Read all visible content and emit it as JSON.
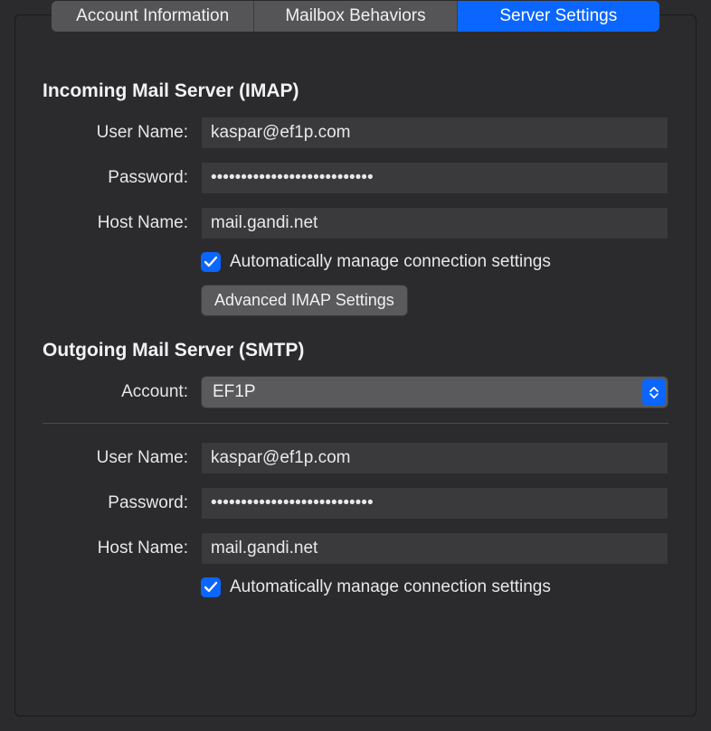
{
  "tabs": {
    "account_info": "Account Information",
    "mailbox_behaviors": "Mailbox Behaviors",
    "server_settings": "Server Settings"
  },
  "incoming": {
    "title": "Incoming Mail Server (IMAP)",
    "username_label": "User Name:",
    "username_value": "kaspar@ef1p.com",
    "password_label": "Password:",
    "password_value": "•••••••••••••••••••••••••••",
    "hostname_label": "Host Name:",
    "hostname_value": "mail.gandi.net",
    "auto_manage_label": "Automatically manage connection settings",
    "advanced_button": "Advanced IMAP Settings"
  },
  "outgoing": {
    "title": "Outgoing Mail Server (SMTP)",
    "account_label": "Account:",
    "account_value": "EF1P",
    "username_label": "User Name:",
    "username_value": "kaspar@ef1p.com",
    "password_label": "Password:",
    "password_value": "•••••••••••••••••••••••••••",
    "hostname_label": "Host Name:",
    "hostname_value": "mail.gandi.net",
    "auto_manage_label": "Automatically manage connection settings"
  }
}
